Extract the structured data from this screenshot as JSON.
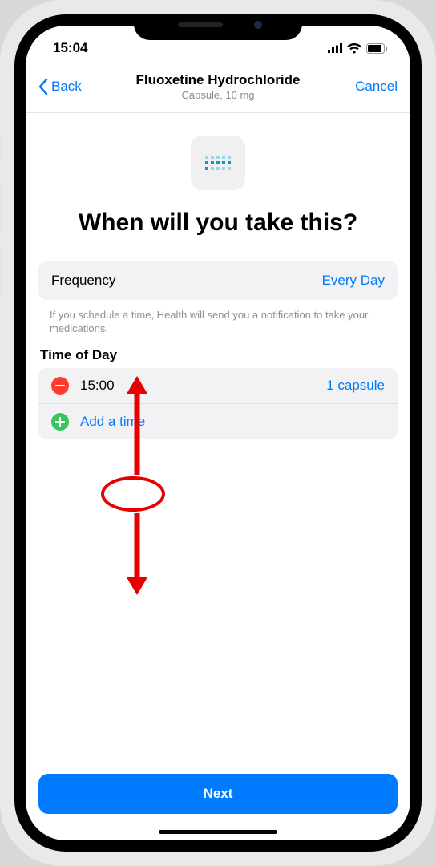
{
  "status": {
    "time": "15:04"
  },
  "nav": {
    "back": "Back",
    "title": "Fluoxetine Hydrochloride",
    "subtitle": "Capsule, 10 mg",
    "cancel": "Cancel"
  },
  "hero": {
    "title": "When will you take this?"
  },
  "frequency": {
    "label": "Frequency",
    "value": "Every Day"
  },
  "hint": "If you schedule a time, Health will send you a notification to take your medications.",
  "timeSection": {
    "label": "Time of Day"
  },
  "times": [
    {
      "time": "15:00",
      "quantity": "1 capsule"
    }
  ],
  "addTime": "Add a time",
  "next": "Next"
}
